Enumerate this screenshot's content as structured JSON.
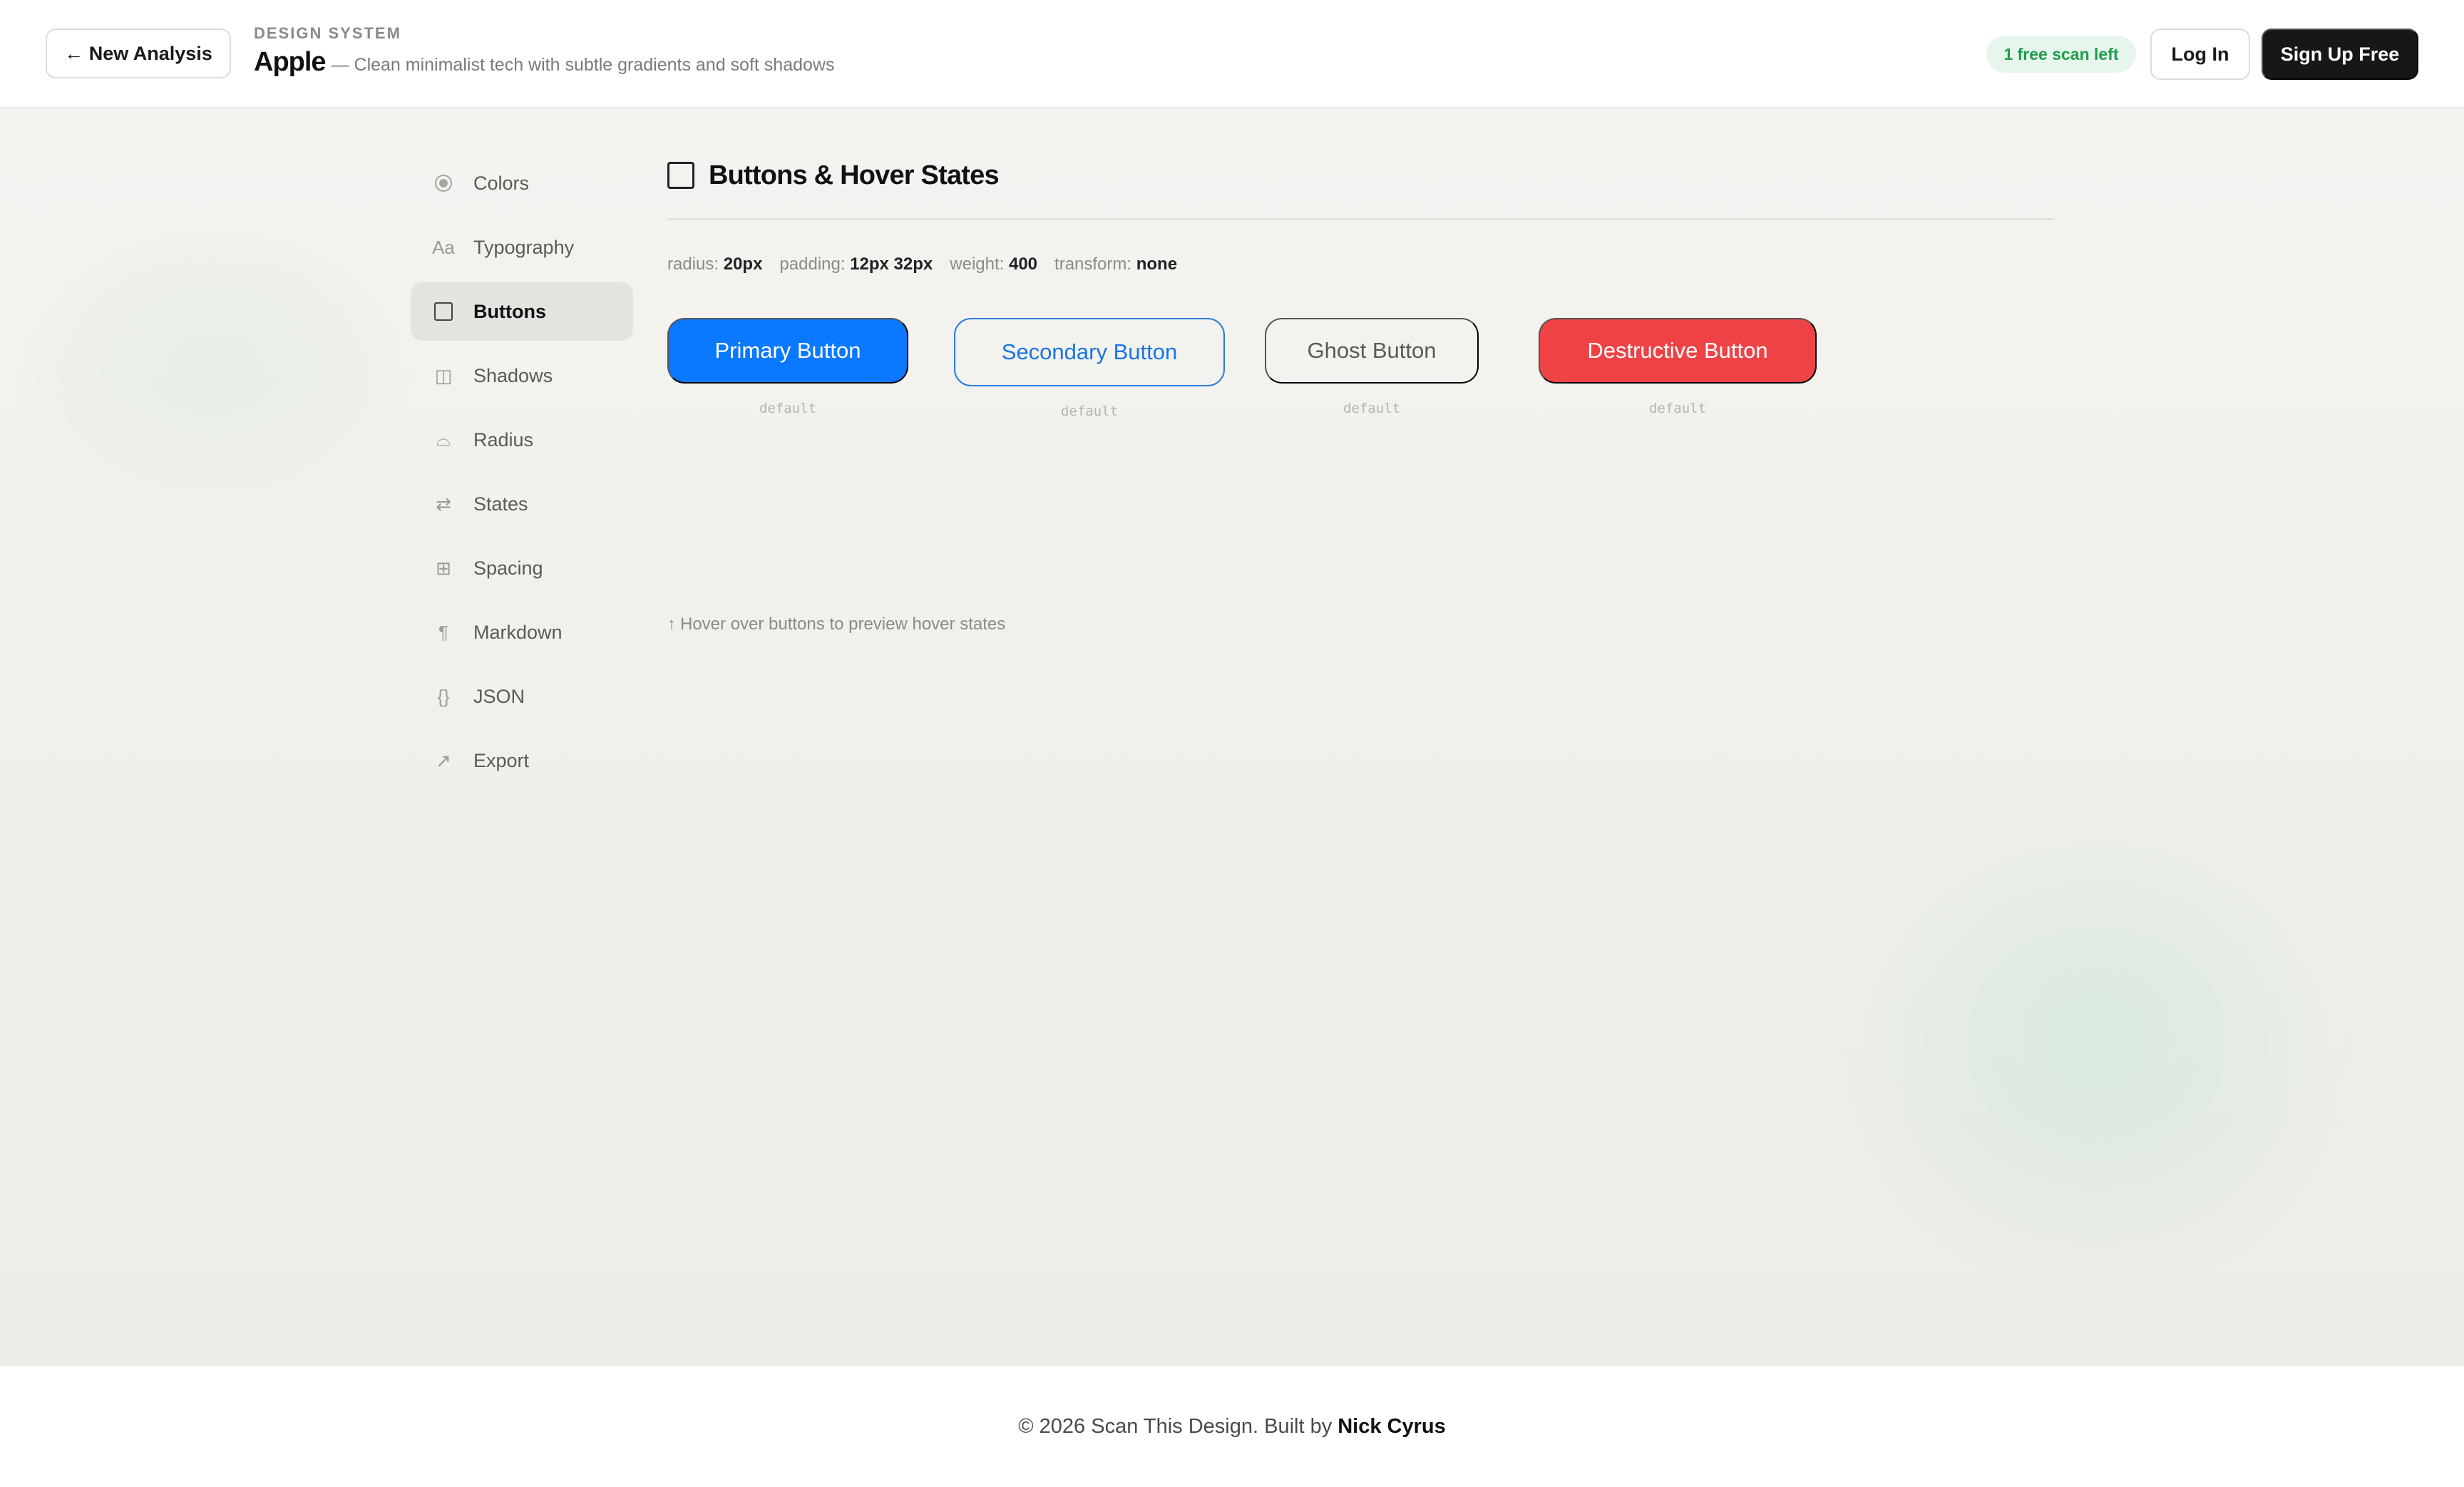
{
  "header": {
    "new_analysis": "← New Analysis",
    "eyebrow": "DESIGN SYSTEM",
    "brand": "Apple",
    "tagline": "— Clean minimalist tech with subtle gradients and soft shadows",
    "free_badge": "1 free scan left",
    "login": "Log In",
    "signup": "Sign Up Free"
  },
  "sidebar": {
    "items": [
      {
        "label": "Colors",
        "icon": "palette-icon"
      },
      {
        "label": "Typography",
        "icon": "typography-icon",
        "glyph": "Aa"
      },
      {
        "label": "Buttons",
        "icon": "button-square-icon",
        "active": true
      },
      {
        "label": "Shadows",
        "icon": "shadow-icon",
        "glyph": "◫"
      },
      {
        "label": "Radius",
        "icon": "radius-icon",
        "glyph": "⌓"
      },
      {
        "label": "States",
        "icon": "swap-arrows-icon",
        "glyph": "⇄"
      },
      {
        "label": "Spacing",
        "icon": "grid-icon",
        "glyph": "⊞"
      },
      {
        "label": "Markdown",
        "icon": "pilcrow-icon",
        "glyph": "¶"
      },
      {
        "label": "JSON",
        "icon": "braces-icon",
        "glyph": "{}"
      },
      {
        "label": "Export",
        "icon": "export-arrow-icon",
        "glyph": "↗"
      }
    ]
  },
  "content": {
    "title": "Buttons & Hover States",
    "specs": {
      "radius_label": "radius:",
      "radius_value": "20px",
      "padding_label": "padding:",
      "padding_value": "12px 32px",
      "weight_label": "weight:",
      "weight_value": "400",
      "transform_label": "transform:",
      "transform_value": "none"
    },
    "buttons": {
      "primary": "Primary Button",
      "secondary": "Secondary Button",
      "ghost": "Ghost Button",
      "destructive": "Destructive Button"
    },
    "state_label": "default",
    "hint": "Hover over buttons to preview hover states",
    "hint_icon": "↑"
  },
  "footer": {
    "text": "© 2026 Scan This Design. Built by",
    "author": "Nick Cyrus"
  },
  "colors": {
    "primary": "#0a78ff",
    "secondary_border": "#2a7de1",
    "destructive": "#ee4245",
    "badge_bg": "#e7f6ec",
    "badge_text": "#1f9d4d",
    "signup_bg": "#171717"
  }
}
